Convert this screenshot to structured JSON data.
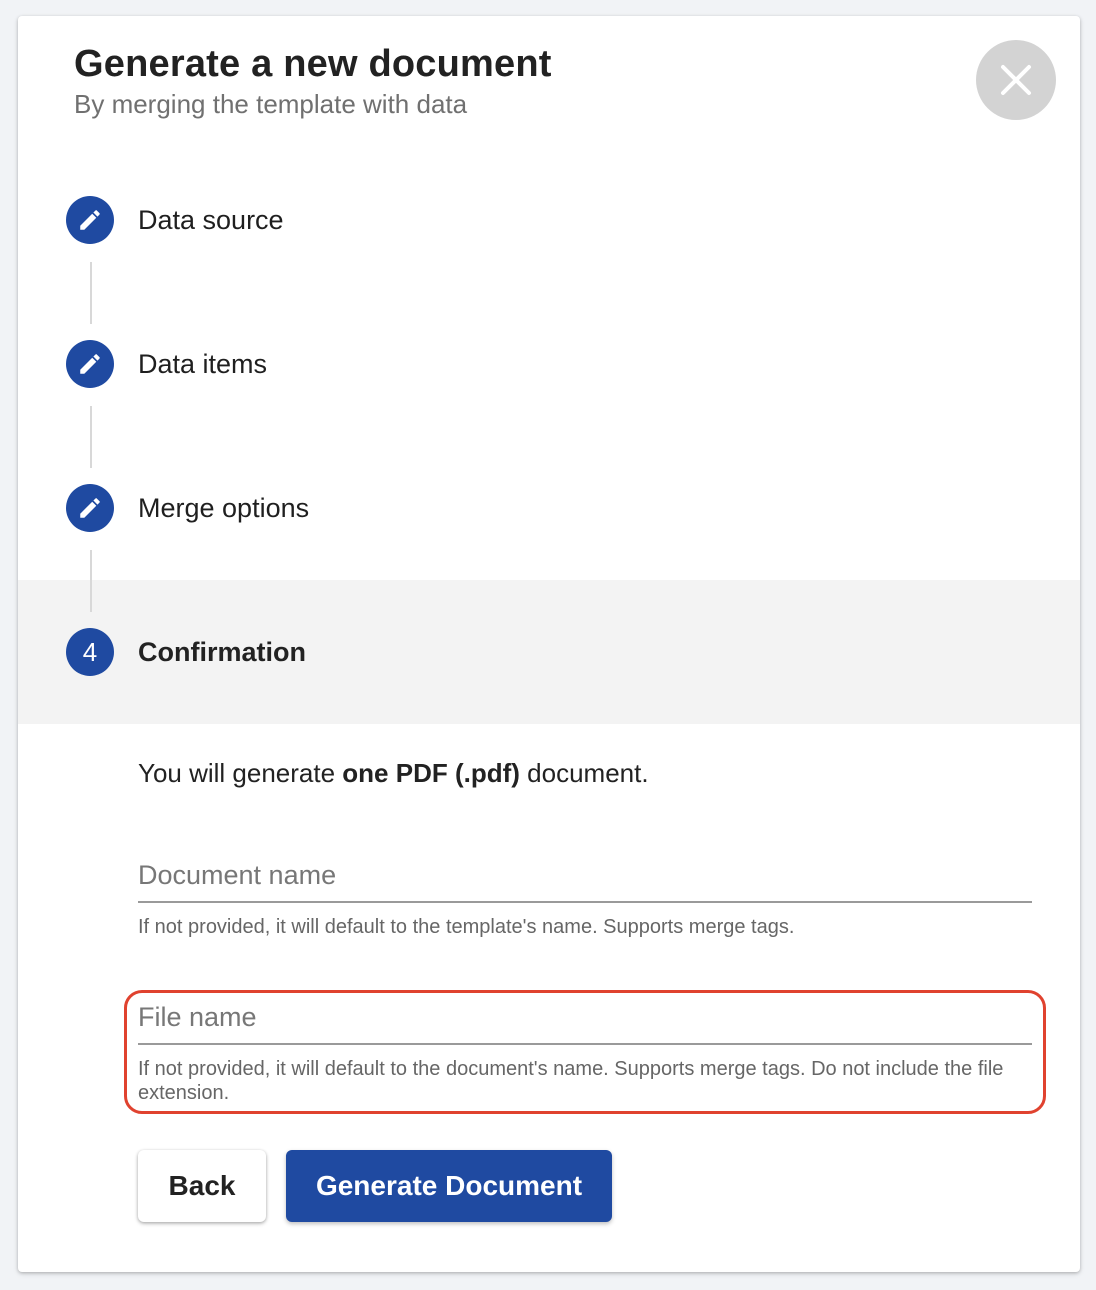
{
  "header": {
    "title": "Generate a new document",
    "subtitle": "By merging the template with data",
    "close_icon": "close-icon"
  },
  "steps": [
    {
      "label": "Data source",
      "icon": "pencil-icon",
      "state": "done"
    },
    {
      "label": "Data items",
      "icon": "pencil-icon",
      "state": "done"
    },
    {
      "label": "Merge options",
      "icon": "pencil-icon",
      "state": "done"
    },
    {
      "label": "Confirmation",
      "number": "4",
      "state": "active"
    }
  ],
  "confirmation": {
    "summary_prefix": "You will generate ",
    "summary_bold": "one PDF (.pdf)",
    "summary_suffix": " document."
  },
  "fields": {
    "document_name": {
      "placeholder": "Document name",
      "value": "",
      "hint": "If not provided, it will default to the template's name. Supports merge tags."
    },
    "file_name": {
      "placeholder": "File name",
      "value": "",
      "hint": "If not provided, it will default to the document's name. Supports merge tags. Do not include the file extension."
    }
  },
  "buttons": {
    "back": "Back",
    "generate": "Generate Document"
  },
  "colors": {
    "primary": "#1f4aa1",
    "highlight": "#e0422f",
    "close_bg": "#d3d3d3"
  }
}
